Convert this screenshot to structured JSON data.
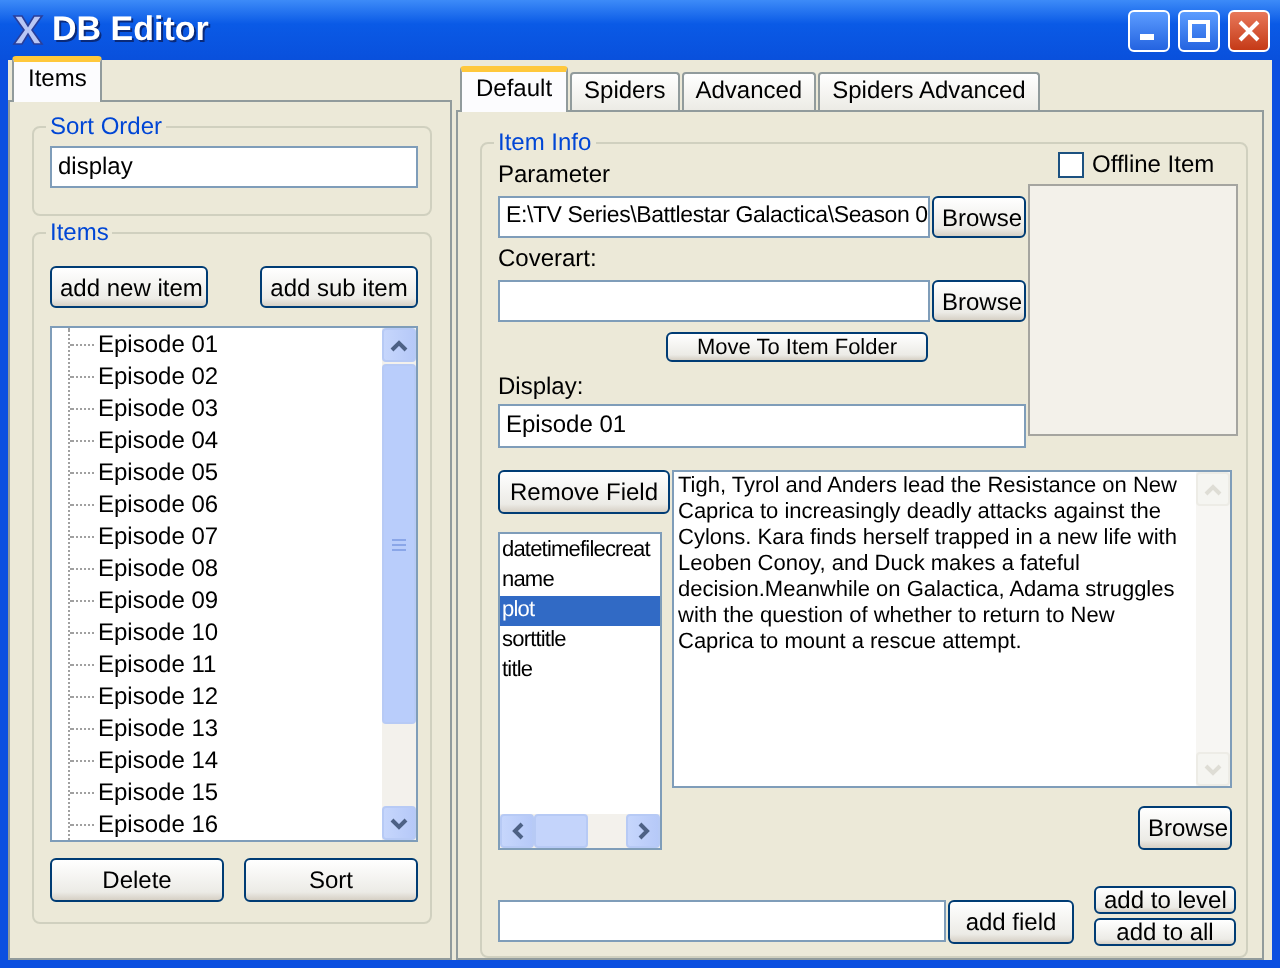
{
  "window": {
    "title": "DB Editor"
  },
  "left_tabs": [
    {
      "label": "Items",
      "selected": true
    }
  ],
  "sort_order": {
    "label": "Sort Order",
    "value": "display"
  },
  "items": {
    "label": "Items",
    "add_new_button": "add new item",
    "add_sub_button": "add sub item",
    "tree": [
      {
        "label": "Episode 01"
      },
      {
        "label": "Episode 02"
      },
      {
        "label": "Episode 03"
      },
      {
        "label": "Episode 04"
      },
      {
        "label": "Episode 05"
      },
      {
        "label": "Episode 06"
      },
      {
        "label": "Episode 07"
      },
      {
        "label": "Episode 08"
      },
      {
        "label": "Episode 09"
      },
      {
        "label": "Episode 10"
      },
      {
        "label": "Episode 11"
      },
      {
        "label": "Episode 12"
      },
      {
        "label": "Episode 13"
      },
      {
        "label": "Episode 14"
      },
      {
        "label": "Episode 15"
      },
      {
        "label": "Episode 16"
      }
    ],
    "delete_button": "Delete",
    "sort_button": "Sort"
  },
  "right_tabs": [
    {
      "label": "Default",
      "selected": true
    },
    {
      "label": "Spiders",
      "selected": false
    },
    {
      "label": "Advanced",
      "selected": false
    },
    {
      "label": "Spiders Advanced",
      "selected": false
    }
  ],
  "item_info": {
    "label": "Item Info",
    "offline_item": {
      "label": "Offline Item",
      "checked": false
    },
    "parameter": {
      "label": "Parameter",
      "value": "E:\\TV Series\\Battlestar Galactica\\Season 0",
      "button": "Browse"
    },
    "coverart": {
      "label": "Coverart:",
      "button": "Browse"
    },
    "move_button": "Move To Item Folder",
    "display": {
      "label": "Display:",
      "value": "Episode 01"
    },
    "remove_field_button": "Remove Field",
    "fields": [
      {
        "label": "datetimefilecreat",
        "selected": false
      },
      {
        "label": "name",
        "selected": false
      },
      {
        "label": "plot",
        "selected": true
      },
      {
        "label": "sorttitle",
        "selected": false
      },
      {
        "label": "title",
        "selected": false
      }
    ],
    "field_value": "Tigh, Tyrol and Anders lead the Resistance on New Caprica to increasingly deadly attacks against the Cylons. Kara finds herself trapped in a new life with Leoben Conoy, and Duck makes a fateful decision.Meanwhile on Galactica, Adama struggles with the question of whether to return to New Caprica to mount a rescue attempt.",
    "value_browse_button": "Browse",
    "add_field_button": "add field",
    "add_to_level_button": "add to level",
    "add_to_all_button": "add to all"
  }
}
